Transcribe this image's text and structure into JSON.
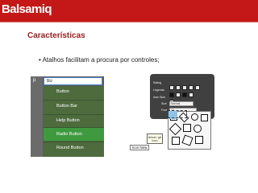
{
  "brand": {
    "name": "Balsamiq"
  },
  "slide": {
    "title": "Características",
    "bullet": "• Atalhos facilitam a procura por controles;"
  },
  "palette": {
    "side_glyph": "p",
    "search_value": "bu",
    "items": [
      {
        "label": "Button",
        "selected": false
      },
      {
        "label": "Button Bar",
        "selected": false
      },
      {
        "label": "Help Button",
        "selected": false
      },
      {
        "label": "Radio Button",
        "selected": true
      },
      {
        "label": "Round Button",
        "selected": false
      }
    ]
  },
  "editor": {
    "labels": {
      "rating": "Rating",
      "legend": "Legenda",
      "auto_size": "Auto Size",
      "size": "Size",
      "font": "Font"
    },
    "size_value": "Normal",
    "font_value": "12",
    "note_text": "default / get icons",
    "new_button": "Icon New"
  }
}
